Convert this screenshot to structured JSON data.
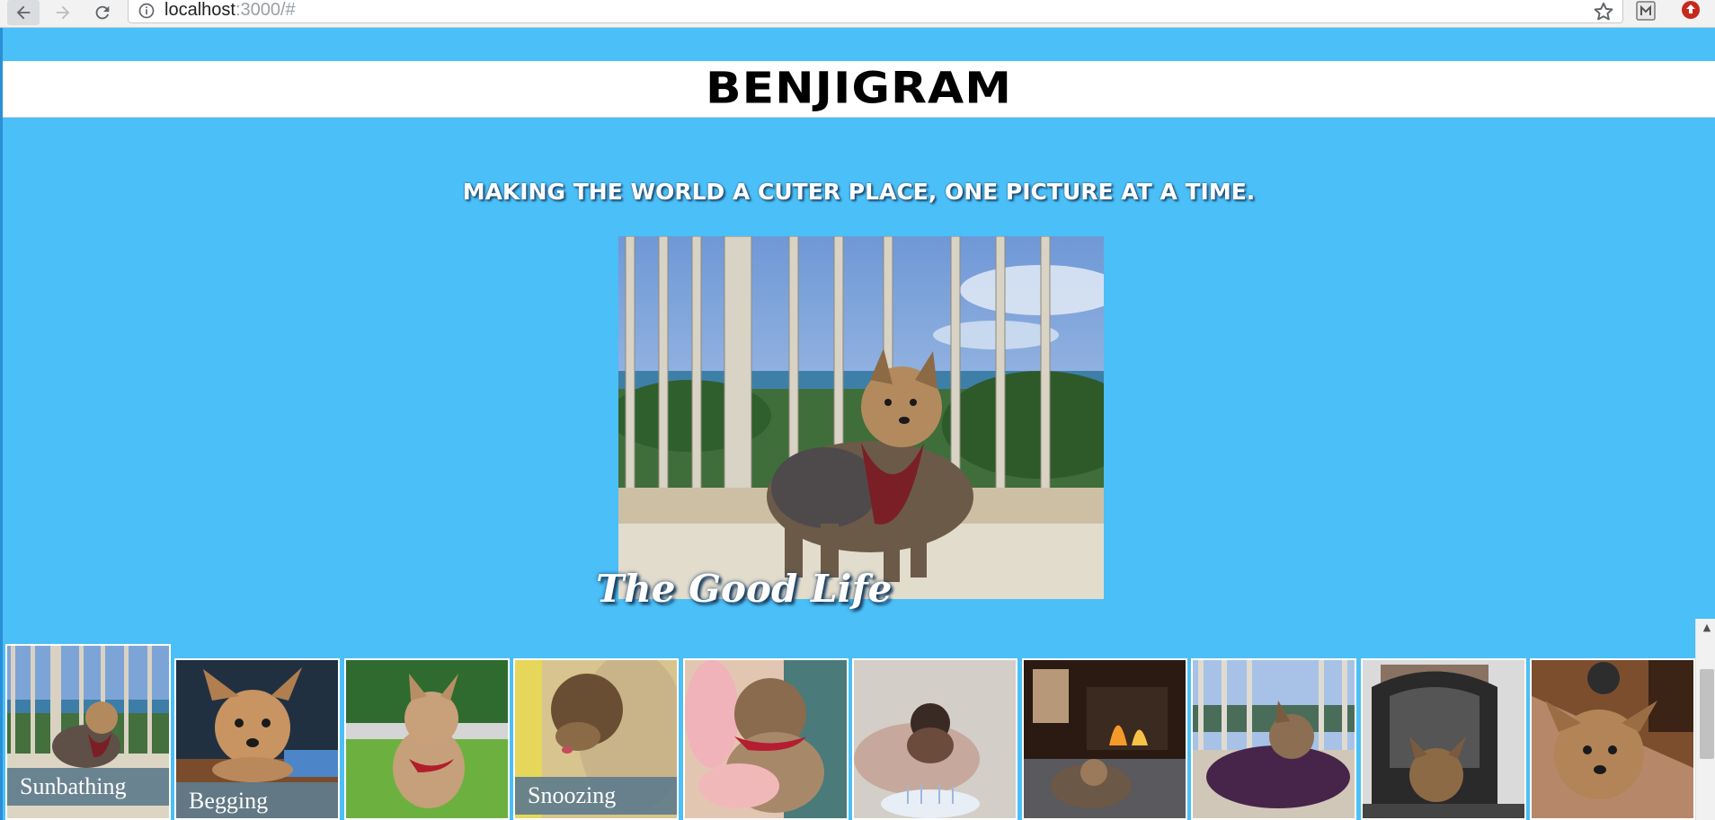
{
  "browser": {
    "url_host": "localhost",
    "url_rest": ":3000/#",
    "icons": {
      "back": "back-arrow-icon",
      "forward": "forward-arrow-icon",
      "reload": "reload-icon",
      "info": "info-icon",
      "bookmark": "star-icon",
      "extension": "extension-icon",
      "update": "update-icon"
    }
  },
  "header": {
    "title": "BENJIGRAM"
  },
  "tagline": "MAKING THE WORLD A CUTER PLACE, ONE PICTURE AT A TIME.",
  "featured": {
    "caption": "The Good Life",
    "image": "yorkie-on-balcony-ocean-view"
  },
  "thumbnails": [
    {
      "label": "Sunbathing",
      "image": "yorkie-on-balcony"
    },
    {
      "label": "Begging",
      "image": "yorkie-on-table"
    },
    {
      "label": "",
      "image": "yorkie-in-grass"
    },
    {
      "label": "Snoozing",
      "image": "yorkie-on-blanket"
    },
    {
      "label": "",
      "image": "yorkie-held-by-person"
    },
    {
      "label": "",
      "image": "puppy-with-cake"
    },
    {
      "label": "",
      "image": "yorkie-by-fireplace"
    },
    {
      "label": "",
      "image": "yorkie-on-balcony-purple"
    },
    {
      "label": "",
      "image": "yorkie-in-stroller"
    },
    {
      "label": "",
      "image": "yorkie-on-rug"
    }
  ],
  "colors": {
    "page_background": "#4bbff7",
    "header_background": "#ffffff",
    "caption_overlay": "#607c8c"
  }
}
